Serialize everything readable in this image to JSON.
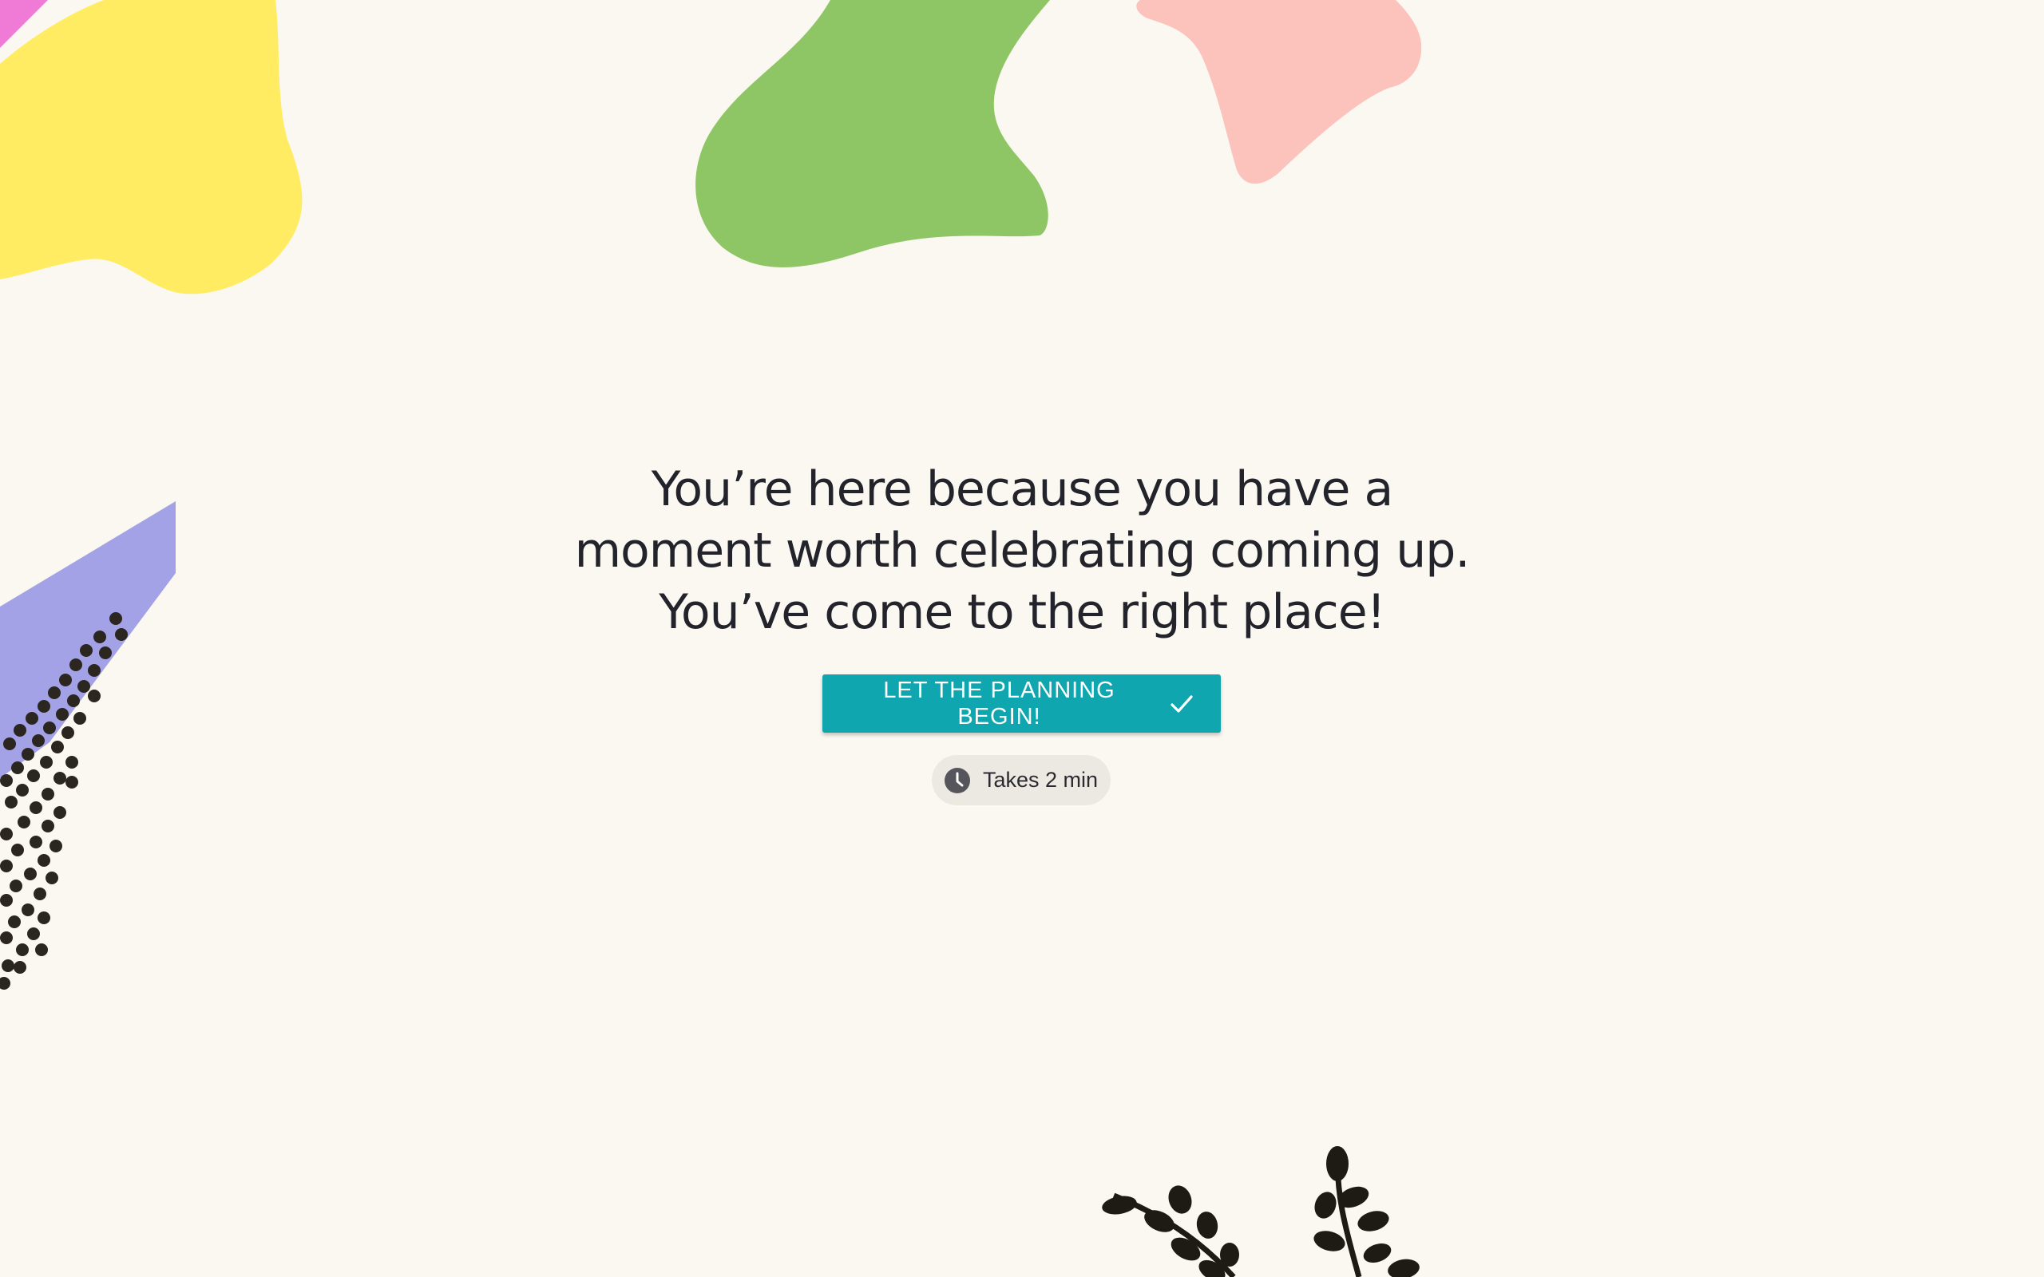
{
  "hero": {
    "headline_lines": [
      "You’re here because you have a",
      "moment worth celebrating coming up.",
      "You’ve come to the right place!"
    ],
    "cta_label": "LET THE PLANNING BEGIN!",
    "cta_icon": "checkmark-icon",
    "time_label": "Takes 2 min",
    "time_icon": "clock-icon"
  },
  "colors": {
    "background": "#FBF8F1",
    "accent": "#0FA6B0",
    "headline": "#23232B",
    "blob_yellow": "#FFEC62",
    "blob_green": "#8FC665",
    "blob_pink": "#FCC3BC",
    "blob_magenta": "#F07BD6",
    "blob_lavender": "#A3A2E6",
    "ink": "#1E1A14"
  }
}
